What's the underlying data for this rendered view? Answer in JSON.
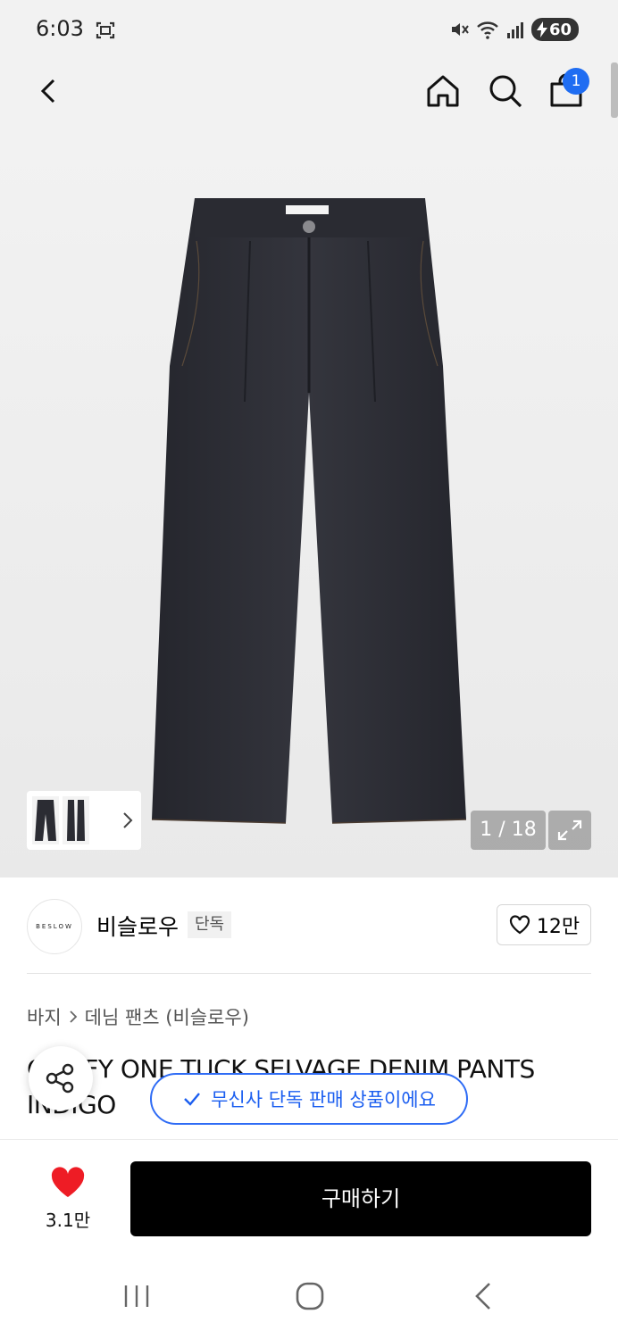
{
  "status": {
    "time": "6:03",
    "battery": "60"
  },
  "header": {
    "cart_count": "1"
  },
  "gallery": {
    "counter": "1 / 18"
  },
  "brand": {
    "logo_text": "BESLOW",
    "name": "비슬로우",
    "tag": "단독",
    "likes": "12만"
  },
  "breadcrumb": {
    "category": "바지",
    "subcategory": "데님 팬츠 (비슬로우)"
  },
  "product": {
    "title": "COMFY ONE TUCK SELVAGE DENIM PANTS INDIGO"
  },
  "toast": {
    "text": "무신사 단독 판매 상품이에요"
  },
  "bottom": {
    "wish_count": "3.1만",
    "buy_label": "구매하기"
  },
  "colors": {
    "accent_blue": "#1f6df2",
    "heart_red": "#ee1c25",
    "buy_button": "#000000"
  }
}
